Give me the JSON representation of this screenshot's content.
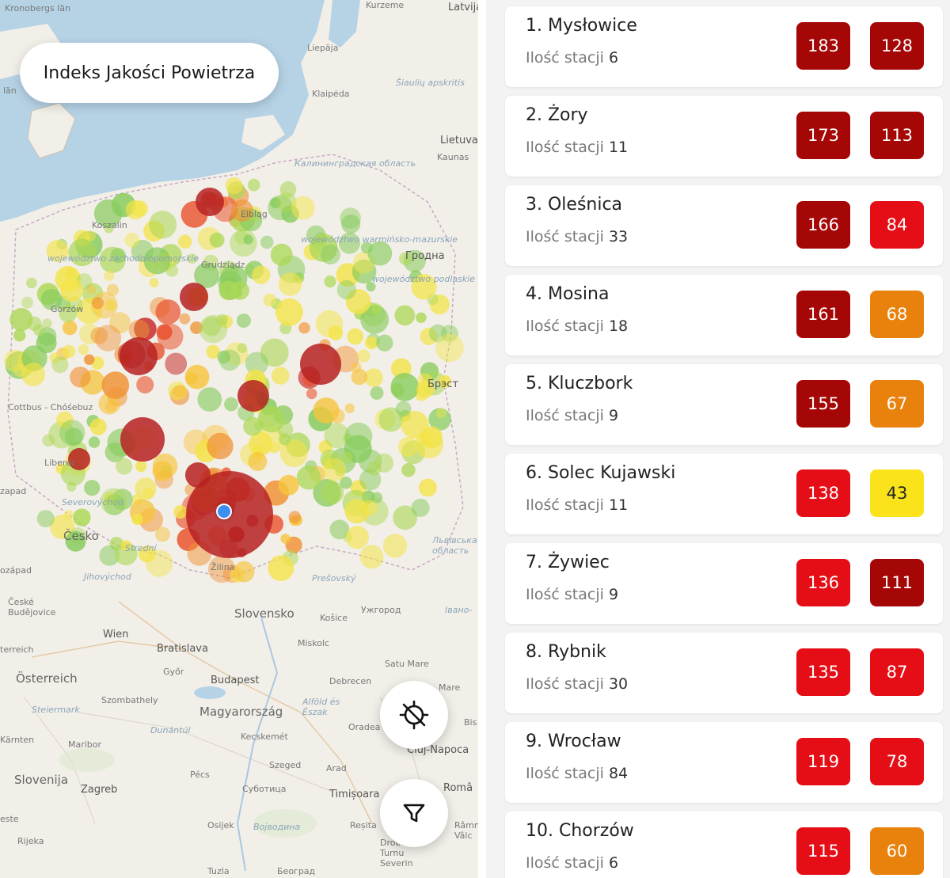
{
  "map": {
    "title": "Indeks Jakości Powietrza",
    "fab_location_icon": "gps-off-icon",
    "fab_filter_icon": "filter-icon",
    "labels": {
      "kronoberg": "Kronobergs län",
      "latvija": "Latvija",
      "kurzeme": "Kurzeme",
      "liepaja": "Liepāja",
      "siaulia": "Šiaulių apskritis",
      "klaipeda": "Klaipėda",
      "lietuva": "Lietuva",
      "kaunas": "Kaunas",
      "kaliningrad": "Калининградская область",
      "koszalin": "Koszalin",
      "elblag": "Elbląg",
      "grudziadz": "Grudziądz",
      "warminsko": "województwo warmińsko-mazurskie",
      "grodno": "Гродна",
      "zachodniopomorskie": "województwo zachodniopomorskie",
      "podlaskie": "województwo podlaskie",
      "gorzow": "Gorzów",
      "brest": "Брэст",
      "cottbus": "Cottbus - Chóśebuz",
      "liberec": "Liberec",
      "cesko": "Česko",
      "dolnoslaskie": "Severovýchod",
      "strední": "Strední",
      "jihovych": "Jihovýchod",
      "zilina": "Žilina",
      "presovsky": "Prešovský",
      "lvivska": "Львівська область",
      "ivano": "Івано-",
      "uzhorod": "Ужгород",
      "ceske": "České Budějovice",
      "slovensko": "Slovensko",
      "kosice": "Košice",
      "wien": "Wien",
      "bratislava": "Bratislava",
      "miskolc": "Miskolc",
      "satu_mare": "Satu Mare",
      "osterreich": "Österreich",
      "gyor": "Győr",
      "budapest": "Budapest",
      "debrecen": "Debrecen",
      "szombathely": "Szombathely",
      "steiermark": "Steiermark",
      "magyarorszag": "Magyarország",
      "alfold": "Alföld és Észak",
      "dunantul": "Dunántúl",
      "oradea": "Oradea",
      "karnten": "Kärnten",
      "maribor": "Maribor",
      "kecskemet": "Kecskemét",
      "cluj": "Cluj-Napoca",
      "slovenija": "Slovenija",
      "zagreb": "Zagreb",
      "pecs": "Pécs",
      "szeged": "Szeged",
      "arad": "Arad",
      "subotica": "Суботица",
      "timisoara": "Timișoara",
      "romania": "Româ",
      "rijeka": "Rijeka",
      "osijek": "Osijek",
      "vojvodina": "Војводина",
      "resita": "Reșita",
      "drobeta": "Drobeta-Turnu Severin",
      "tuzla": "Tuzla",
      "beograd": "Београд",
      "ramnicu": "Râmn Vâlc",
      "este": "este",
      "bis": "Bis",
      "mare": "Mare",
      "zapad": "zapad",
      "ozapad": "ozápad",
      "terreich": "terreich",
      "lan": "län"
    }
  },
  "list": {
    "stations_label": "Ilość stacji",
    "items": [
      {
        "name": "1. Mysłowice",
        "stations": "6",
        "v1": "183",
        "v2": "128",
        "c1": "#a50606",
        "c2": "#a50606",
        "d1": false,
        "d2": false
      },
      {
        "name": "2. Żory",
        "stations": "11",
        "v1": "173",
        "v2": "113",
        "c1": "#a50606",
        "c2": "#a50606",
        "d1": false,
        "d2": false
      },
      {
        "name": "3. Oleśnica",
        "stations": "33",
        "v1": "166",
        "v2": "84",
        "c1": "#a50606",
        "c2": "#e50e17",
        "d1": false,
        "d2": false
      },
      {
        "name": "4. Mosina",
        "stations": "18",
        "v1": "161",
        "v2": "68",
        "c1": "#a50606",
        "c2": "#e8820c",
        "d1": false,
        "d2": false
      },
      {
        "name": "5. Kluczbork",
        "stations": "9",
        "v1": "155",
        "v2": "67",
        "c1": "#a50606",
        "c2": "#e8820c",
        "d1": false,
        "d2": false
      },
      {
        "name": "6. Solec Kujawski",
        "stations": "11",
        "v1": "138",
        "v2": "43",
        "c1": "#e50e17",
        "c2": "#fbe31c",
        "d1": false,
        "d2": true
      },
      {
        "name": "7. Żywiec",
        "stations": "9",
        "v1": "136",
        "v2": "111",
        "c1": "#e50e17",
        "c2": "#a50606",
        "d1": false,
        "d2": false
      },
      {
        "name": "8. Rybnik",
        "stations": "30",
        "v1": "135",
        "v2": "87",
        "c1": "#e50e17",
        "c2": "#e50e17",
        "d1": false,
        "d2": false
      },
      {
        "name": "9. Wrocław",
        "stations": "84",
        "v1": "119",
        "v2": "78",
        "c1": "#e50e17",
        "c2": "#e50e17",
        "d1": false,
        "d2": false
      },
      {
        "name": "10. Chorzów",
        "stations": "6",
        "v1": "115",
        "v2": "60",
        "c1": "#e50e17",
        "c2": "#e8820c",
        "d1": false,
        "d2": false
      }
    ]
  }
}
